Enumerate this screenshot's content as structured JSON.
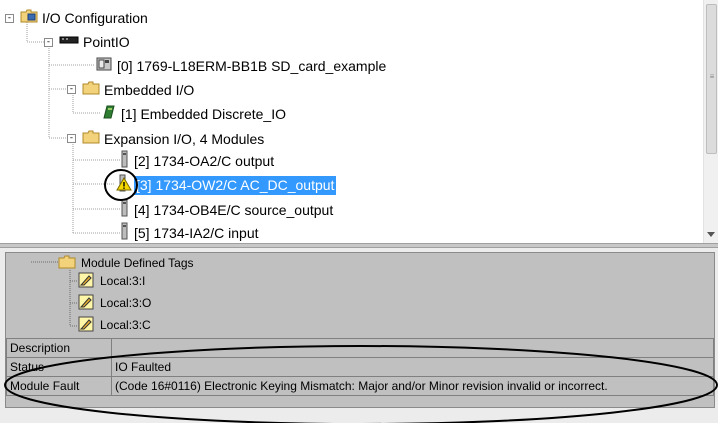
{
  "tree": {
    "items": [
      {
        "label": "I/O Configuration",
        "icon": "io-configuration-folder-icon"
      },
      {
        "label": "PointIO",
        "icon": "pointio-network-icon"
      },
      {
        "label": "[0] 1769-L18ERM-BB1B SD_card_example",
        "icon": "controller-icon"
      },
      {
        "label": "Embedded I/O",
        "icon": "folder-icon"
      },
      {
        "label": "[1] Embedded Discrete_IO",
        "icon": "discrete-io-module-icon"
      },
      {
        "label": "Expansion I/O, 4 Modules",
        "icon": "folder-icon"
      },
      {
        "label": "[2] 1734-OA2/C output",
        "icon": "io-module-icon"
      },
      {
        "label": "[3] 1734-OW2/C AC_DC_output",
        "icon": "warning-icon",
        "selected": true
      },
      {
        "label": "[4] 1734-OB4E/C source_output",
        "icon": "io-module-icon"
      },
      {
        "label": "[5] 1734-IA2/C input",
        "icon": "io-module-icon"
      }
    ],
    "expanders": [
      "-",
      "-",
      "-",
      "-"
    ]
  },
  "props": {
    "folder_label": "Module Defined Tags",
    "tags": [
      "Local:3:I",
      "Local:3:O",
      "Local:3:C"
    ],
    "rows": [
      {
        "key": "Description",
        "value": ""
      },
      {
        "key": "Status",
        "value": "IO Faulted"
      },
      {
        "key": "Module Fault",
        "value": "(Code 16#0116) Electronic Keying Mismatch: Major and/or Minor revision invalid or incorrect."
      }
    ]
  },
  "colors": {
    "selection": "#3399ff",
    "folder": "#f2d27a",
    "warning": "#f5d800",
    "annotation": "#000000"
  }
}
